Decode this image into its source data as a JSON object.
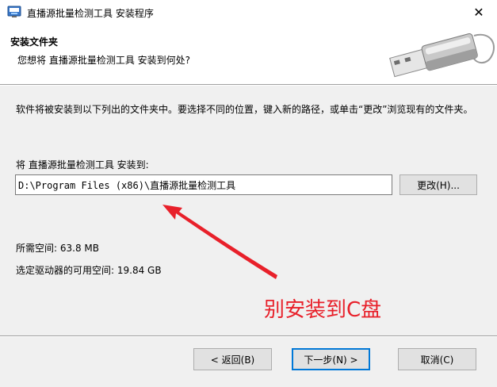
{
  "window": {
    "title": "直播源批量检测工具 安装程序",
    "close_glyph": "✕"
  },
  "header": {
    "title": "安装文件夹",
    "subtitle": "您想将 直播源批量检测工具 安装到何处?"
  },
  "main": {
    "description": "软件将被安装到以下列出的文件夹中。要选择不同的位置，键入新的路径，或单击“更改”浏览现有的文件夹。",
    "install_label": "将 直播源批量检测工具 安装到:",
    "install_path": "D:\\Program Files (x86)\\直播源批量检测工具",
    "browse_label": "更改(H)...",
    "space_required": "所需空间: 63.8 MB",
    "space_available": "选定驱动器的可用空间: 19.84 GB"
  },
  "annotation": {
    "text": "别安装到C盘",
    "color": "#e8202a"
  },
  "footer": {
    "back_label": "< 返回(B)",
    "next_label": "下一步(N) >",
    "cancel_label": "取消(C)"
  },
  "icons": {
    "app": "installer-app-icon",
    "header": "usb-drive-icon"
  }
}
